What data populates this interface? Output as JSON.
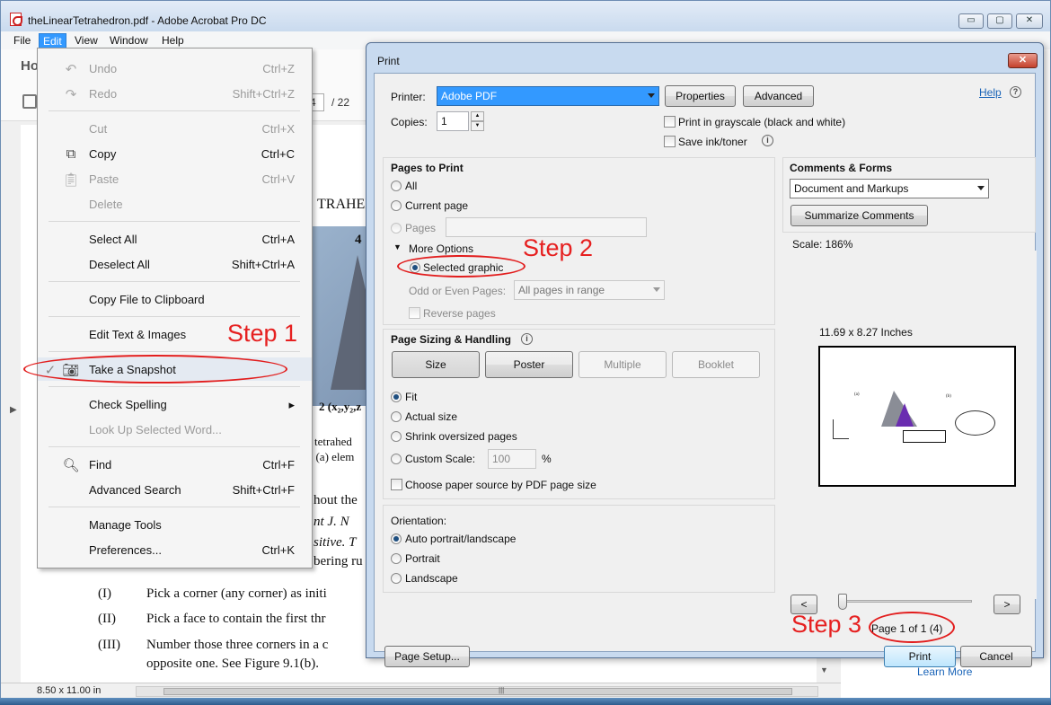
{
  "app": {
    "title": "theLinearTetrahedron.pdf - Adobe Acrobat Pro DC",
    "window_min": "▭",
    "window_max": "▢",
    "window_close": "✕"
  },
  "menubar": [
    "File",
    "Edit",
    "View",
    "Window",
    "Help"
  ],
  "toolbar": {
    "home_tab": "Ho",
    "page_current": "4",
    "page_total": "/ 22"
  },
  "edit_menu": [
    {
      "label": "Undo",
      "shortcut": "Ctrl+Z",
      "disabled": true,
      "icon": "undo-icon"
    },
    {
      "label": "Redo",
      "shortcut": "Shift+Ctrl+Z",
      "disabled": true,
      "icon": "redo-icon"
    },
    {
      "label": "Cut",
      "shortcut": "Ctrl+X",
      "disabled": true
    },
    {
      "label": "Copy",
      "shortcut": "Ctrl+C",
      "disabled": false,
      "icon": "copy-icon"
    },
    {
      "label": "Paste",
      "shortcut": "Ctrl+V",
      "disabled": true,
      "icon": "paste-icon"
    },
    {
      "label": "Delete",
      "shortcut": "",
      "disabled": true
    },
    {
      "label": "Select All",
      "shortcut": "Ctrl+A",
      "disabled": false
    },
    {
      "label": "Deselect All",
      "shortcut": "Shift+Ctrl+A",
      "disabled": false
    },
    {
      "label": "Copy File to Clipboard",
      "shortcut": "",
      "disabled": false
    },
    {
      "label": "Edit Text & Images",
      "shortcut": "",
      "disabled": false
    },
    {
      "label": "Take a Snapshot",
      "shortcut": "",
      "disabled": false,
      "checked": true,
      "icon": "camera-icon"
    },
    {
      "label": "Check Spelling",
      "shortcut": "▸",
      "disabled": false
    },
    {
      "label": "Look Up Selected Word...",
      "shortcut": "",
      "disabled": true
    },
    {
      "label": "Find",
      "shortcut": "Ctrl+F",
      "disabled": false,
      "icon": "search-icon"
    },
    {
      "label": "Advanced Search",
      "shortcut": "Shift+Ctrl+F",
      "disabled": false
    },
    {
      "label": "Manage Tools",
      "shortcut": "",
      "disabled": false
    },
    {
      "label": "Preferences...",
      "shortcut": "Ctrl+K",
      "disabled": false
    }
  ],
  "document": {
    "heading_fragment": "TRAHED",
    "fig_label_4": "4",
    "fig_label_2": "2 (x₂,y₂,z",
    "caption1": "e tetrahed",
    "caption2": "t: (a) elem",
    "para1": "hout the",
    "para2": "nt J.  N",
    "para3": "sitive.  T",
    "para4": "bering ru",
    "item1_num": "(I)",
    "item1_text": "Pick a corner (any corner) as initi",
    "item2_num": "(II)",
    "item2_text": "Pick a face to contain the first thr",
    "item3_num": "(III)",
    "item3_text": "Number those three corners in a c",
    "item3_cont": "opposite one.  See Figure 9.1(b).",
    "page_size": "8.50 x 11.00 in",
    "learn_more": "Learn More"
  },
  "print_dialog": {
    "title": "Print",
    "close": "✕",
    "printer_label": "Printer:",
    "printer_value": "Adobe PDF",
    "properties": "Properties",
    "advanced": "Advanced",
    "help": "Help",
    "copies_label": "Copies:",
    "copies_value": "1",
    "grayscale": "Print in grayscale (black and white)",
    "save_ink": "Save ink/toner",
    "pages_to_print": {
      "title": "Pages to Print",
      "all": "All",
      "current_page": "Current page",
      "pages": "Pages",
      "more_options": "More Options",
      "selected_graphic": "Selected graphic",
      "odd_even_label": "Odd or Even Pages:",
      "odd_even_value": "All pages in range",
      "reverse_pages": "Reverse pages"
    },
    "sizing": {
      "title": "Page Sizing & Handling",
      "size": "Size",
      "poster": "Poster",
      "multiple": "Multiple",
      "booklet": "Booklet",
      "fit": "Fit",
      "actual_size": "Actual size",
      "shrink": "Shrink oversized pages",
      "custom_scale": "Custom Scale:",
      "custom_value": "100",
      "percent": "%",
      "paper_source": "Choose paper source by PDF page size"
    },
    "orientation": {
      "title": "Orientation:",
      "auto": "Auto portrait/landscape",
      "portrait": "Portrait",
      "landscape": "Landscape"
    },
    "comments_forms": {
      "title": "Comments & Forms",
      "value": "Document and Markups",
      "summarize": "Summarize Comments"
    },
    "preview": {
      "scale": "Scale: 186%",
      "dimensions": "11.69 x 8.27 Inches",
      "page_label": "Page 1 of 1 (4)",
      "prev": "<",
      "next": ">"
    },
    "page_setup": "Page Setup...",
    "print": "Print",
    "cancel": "Cancel"
  },
  "annotations": {
    "step1": "Step 1",
    "step2": "Step 2",
    "step3": "Step 3",
    "color": "#e62020"
  }
}
